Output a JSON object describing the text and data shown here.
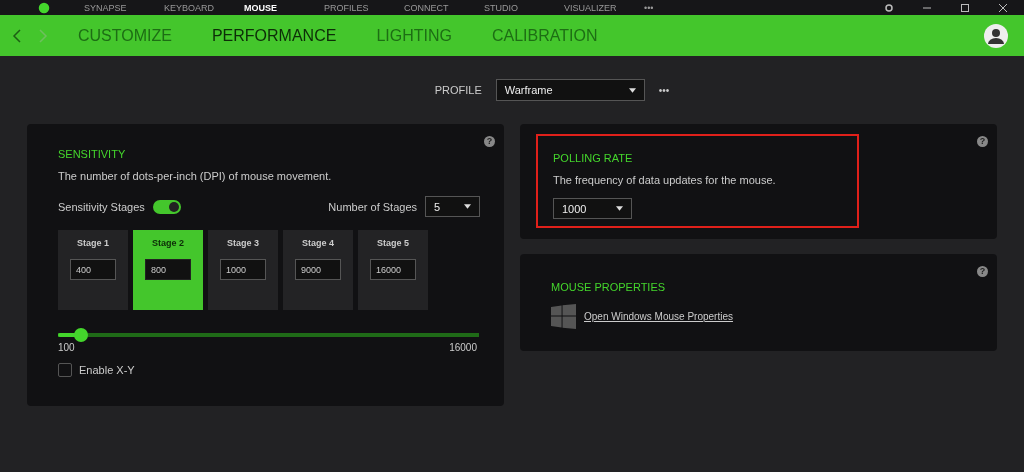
{
  "top_nav": [
    {
      "label": "SYNAPSE",
      "selected": false
    },
    {
      "label": "KEYBOARD",
      "selected": false
    },
    {
      "label": "MOUSE",
      "selected": true
    },
    {
      "label": "PROFILES",
      "selected": false
    },
    {
      "label": "CONNECT",
      "selected": false
    },
    {
      "label": "STUDIO",
      "selected": false
    },
    {
      "label": "VISUALIZER",
      "selected": false
    },
    {
      "label": "•••",
      "selected": false
    }
  ],
  "tabs": [
    {
      "label": "CUSTOMIZE",
      "selected": false
    },
    {
      "label": "PERFORMANCE",
      "selected": true
    },
    {
      "label": "LIGHTING",
      "selected": false
    },
    {
      "label": "CALIBRATION",
      "selected": false
    }
  ],
  "profile": {
    "label": "PROFILE",
    "value": "Warframe",
    "more": "•••"
  },
  "sensitivity": {
    "help": "?",
    "title": "SENSITIVITY",
    "description": "The number of dots-per-inch (DPI) of mouse movement.",
    "stages_label": "Sensitivity Stages",
    "stages_on": true,
    "count_label": "Number of Stages",
    "count": "5",
    "stages": [
      {
        "label": "Stage 1",
        "value": "400",
        "selected": false
      },
      {
        "label": "Stage 2",
        "value": "800",
        "selected": true
      },
      {
        "label": "Stage 3",
        "value": "1000",
        "selected": false
      },
      {
        "label": "Stage 4",
        "value": "9000",
        "selected": false
      },
      {
        "label": "Stage 5",
        "value": "16000",
        "selected": false
      }
    ],
    "slider": {
      "level": 0.055,
      "min": "100",
      "max": "16000"
    },
    "xy": {
      "label": "Enable X-Y",
      "checked": false
    }
  },
  "polling": {
    "help": "?",
    "title": "POLLING RATE",
    "description": "The frequency of data updates for the mouse.",
    "value": "1000",
    "highlighted": true
  },
  "mouse_properties": {
    "help": "?",
    "title": "MOUSE PROPERTIES",
    "link": "Open Windows Mouse Properties"
  }
}
